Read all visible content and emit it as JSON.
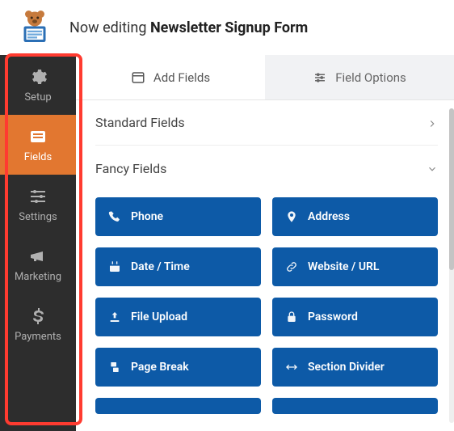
{
  "header": {
    "prefix": "Now editing ",
    "title": "Newsletter Signup Form"
  },
  "sidebar": {
    "items": [
      {
        "label": "Setup",
        "icon": "gear-icon"
      },
      {
        "label": "Fields",
        "icon": "form-icon"
      },
      {
        "label": "Settings",
        "icon": "sliders-icon"
      },
      {
        "label": "Marketing",
        "icon": "megaphone-icon"
      },
      {
        "label": "Payments",
        "icon": "dollar-icon"
      }
    ],
    "active_index": 1
  },
  "tabs": {
    "add_fields": "Add Fields",
    "field_options": "Field Options",
    "active": "add_fields"
  },
  "sections": {
    "standard": {
      "title": "Standard Fields",
      "expanded": false
    },
    "fancy": {
      "title": "Fancy Fields",
      "expanded": true
    }
  },
  "fancy_fields": [
    {
      "label": "Phone",
      "icon": "phone-icon"
    },
    {
      "label": "Address",
      "icon": "map-pin-icon"
    },
    {
      "label": "Date / Time",
      "icon": "calendar-icon"
    },
    {
      "label": "Website / URL",
      "icon": "link-icon"
    },
    {
      "label": "File Upload",
      "icon": "upload-icon"
    },
    {
      "label": "Password",
      "icon": "lock-icon"
    },
    {
      "label": "Page Break",
      "icon": "page-break-icon"
    },
    {
      "label": "Section Divider",
      "icon": "divider-icon"
    }
  ]
}
